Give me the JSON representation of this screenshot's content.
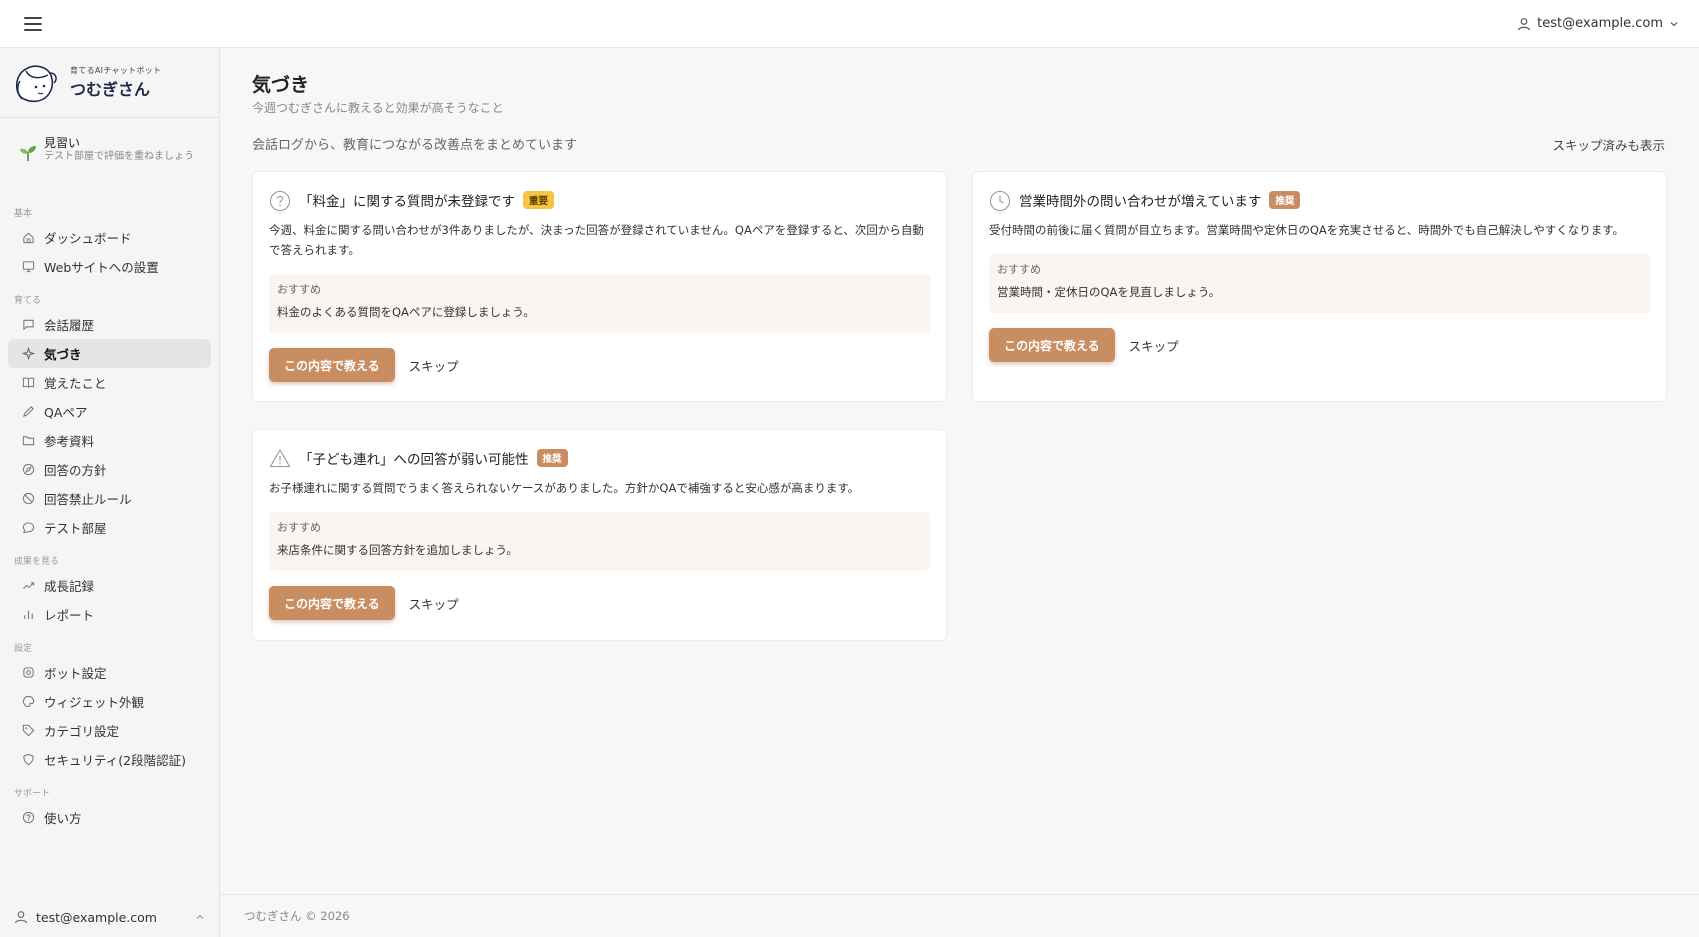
{
  "header": {
    "user_email": "test@example.com"
  },
  "sidebar": {
    "brand_sub": "育てるAIチャットボット",
    "brand_name": "つむぎさん",
    "level_title": "見習い",
    "level_sub": "テスト部屋で評価を重ねましょう",
    "sections": [
      {
        "label": "基本",
        "items": [
          {
            "label": "ダッシュボード",
            "icon": "home-icon"
          },
          {
            "label": "Webサイトへの設置",
            "icon": "monitor-icon"
          }
        ]
      },
      {
        "label": "育てる",
        "items": [
          {
            "label": "会話履歴",
            "icon": "chat-icon"
          },
          {
            "label": "気づき",
            "icon": "sparkle-icon"
          },
          {
            "label": "覚えたこと",
            "icon": "book-icon"
          },
          {
            "label": "QAペア",
            "icon": "pen-icon"
          },
          {
            "label": "参考資料",
            "icon": "folder-icon"
          },
          {
            "label": "回答の方針",
            "icon": "compass-icon"
          },
          {
            "label": "回答禁止ルール",
            "icon": "ban-icon"
          },
          {
            "label": "テスト部屋",
            "icon": "bubble-icon"
          }
        ]
      },
      {
        "label": "成果を見る",
        "items": [
          {
            "label": "成長記録",
            "icon": "trend-icon"
          },
          {
            "label": "レポート",
            "icon": "bar-chart-icon"
          }
        ]
      },
      {
        "label": "設定",
        "items": [
          {
            "label": "ボット設定",
            "icon": "gear-icon"
          },
          {
            "label": "ウィジェット外観",
            "icon": "palette-icon"
          },
          {
            "label": "カテゴリ設定",
            "icon": "tag-icon"
          },
          {
            "label": "セキュリティ(2段階認証)",
            "icon": "shield-icon"
          }
        ]
      },
      {
        "label": "サポート",
        "items": [
          {
            "label": "使い方",
            "icon": "help-icon"
          }
        ]
      }
    ],
    "active_item": "気づき",
    "footer_email": "test@example.com"
  },
  "main": {
    "title": "気づき",
    "subtitle": "今週つむぎさんに教えると効果が高そうなこと",
    "description": "会話ログから、教育につながる改善点をまとめています",
    "show_skipped": "スキップ済みも表示",
    "cards": [
      {
        "icon": "question-icon",
        "title": "「料金」に関する質問が未登録です",
        "badge": "重要",
        "body": "今週、料金に関する問い合わせが3件ありましたが、決まった回答が登録されていません。QAペアを登録すると、次回から自動で答えられます。",
        "reco_label": "おすすめ",
        "reco_text": "料金のよくある質問をQAペアに登録しましょう。",
        "teach_label": "この内容で教える",
        "skip_label": "スキップ"
      },
      {
        "icon": "clock-icon",
        "title": "営業時間外の問い合わせが増えています",
        "badge": "推奨",
        "body": "受付時間の前後に届く質問が目立ちます。営業時間や定休日のQAを充実させると、時間外でも自己解決しやすくなります。",
        "reco_label": "おすすめ",
        "reco_text": "営業時間・定休日のQAを見直しましょう。",
        "teach_label": "この内容で教える",
        "skip_label": "スキップ"
      },
      {
        "icon": "warning-icon",
        "title": "「子ども連れ」への回答が弱い可能性",
        "badge": "推奨",
        "body": "お子様連れに関する質問でうまく答えられないケースがありました。方針かQAで補強すると安心感が高まります。",
        "reco_label": "おすすめ",
        "reco_text": "来店条件に関する回答方針を追加しましょう。",
        "teach_label": "この内容で教える",
        "skip_label": "スキップ"
      }
    ]
  },
  "footer": {
    "copyright": "つむぎさん © 2026"
  },
  "colors": {
    "accent": "#c98d62",
    "badge_important": "#f6c342",
    "reco_bg": "#faf5f1"
  }
}
